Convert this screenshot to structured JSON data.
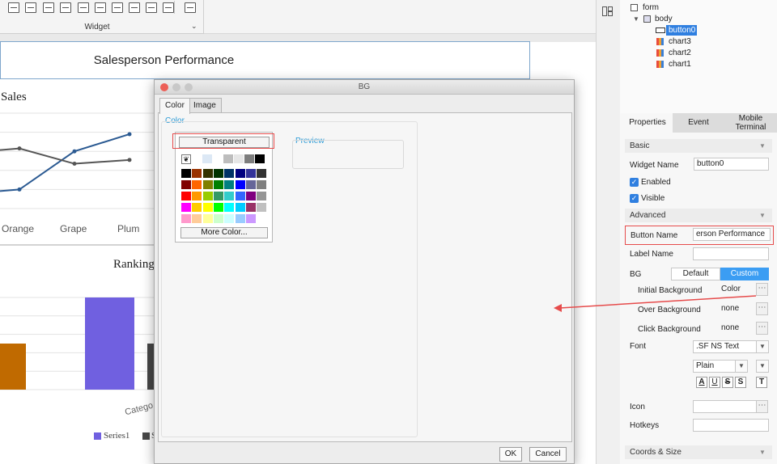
{
  "toolbar": {
    "group_label": "Widget"
  },
  "canvas": {
    "title": "Salesperson Performance",
    "chart3": {
      "title": "Sales",
      "categories": [
        "Orange",
        "Grape",
        "Plum"
      ]
    },
    "chart2": {
      "title": "Ranking",
      "axis_label": "Catego",
      "legend": [
        "Series1",
        "S"
      ]
    }
  },
  "chart_data": [
    {
      "type": "line",
      "title": "Sales",
      "categories": [
        "Orange",
        "Grape",
        "Plum"
      ],
      "series": [
        {
          "values": [
            20,
            60,
            78
          ],
          "color": "#2b5a92"
        },
        {
          "values": [
            63,
            47,
            51
          ],
          "color": "#555555"
        }
      ],
      "ylim": [
        0,
        100
      ],
      "grid": true
    },
    {
      "type": "bar",
      "title": "Ranking",
      "xlabel": "Catego",
      "series": [
        {
          "name": "Series1",
          "values": [
            100
          ],
          "color": "#7060e0"
        },
        {
          "name": "S",
          "values": [
            50
          ],
          "color": "#474747"
        }
      ],
      "partial_values": [
        50
      ],
      "partial_color": "#c06a00",
      "ylim": [
        0,
        100
      ],
      "grid": true
    }
  ],
  "dialog": {
    "title": "BG",
    "tabs": [
      "Color",
      "Image"
    ],
    "section_label": "Color",
    "transparent_label": "Transparent",
    "more_color_label": "More Color...",
    "preview_label": "Preview",
    "ok_label": "OK",
    "cancel_label": "Cancel",
    "top_row_colors": [
      "#dce8f5",
      "#ffffff",
      "#bdbdbd",
      "#e6e6e6",
      "#7d7d7d",
      "#000000"
    ],
    "palette_rows": [
      [
        "#000000",
        "#993300",
        "#333300",
        "#003300",
        "#003366",
        "#000080",
        "#333399",
        "#333333"
      ],
      [
        "#800000",
        "#ff6600",
        "#808000",
        "#008000",
        "#008080",
        "#0000ff",
        "#666699",
        "#808080"
      ],
      [
        "#ff0000",
        "#ff9900",
        "#99cc00",
        "#339966",
        "#33cccc",
        "#3366ff",
        "#800080",
        "#969696"
      ],
      [
        "#ff00ff",
        "#ffcc00",
        "#ffff00",
        "#00ff00",
        "#00ffff",
        "#00ccff",
        "#993366",
        "#c0c0c0"
      ],
      [
        "#ff99cc",
        "#ffcc99",
        "#ffff99",
        "#ccffcc",
        "#ccffff",
        "#99ccff",
        "#cc99ff",
        "#ffffff"
      ]
    ]
  },
  "tree": {
    "items": [
      "form",
      "body",
      "button0",
      "chart3",
      "chart2",
      "chart1"
    ]
  },
  "properties": {
    "tabs": [
      "Properties",
      "Event",
      "Mobile Terminal"
    ],
    "basic_label": "Basic",
    "widget_name_label": "Widget Name",
    "widget_name_value": "button0",
    "enabled_label": "Enabled",
    "visible_label": "Visible",
    "advanced_label": "Advanced",
    "button_name_label": "Button Name",
    "button_name_value": "erson Performance",
    "label_name_label": "Label Name",
    "label_name_value": "",
    "bg_label": "BG",
    "bg_default": "Default",
    "bg_custom": "Custom",
    "initial_bg_label": "Initial Background",
    "initial_bg_value": "Color",
    "over_bg_label": "Over Background",
    "over_bg_value": "none",
    "click_bg_label": "Click Background",
    "click_bg_value": "none",
    "font_label": "Font",
    "font_family_value": ".SF NS Text",
    "font_style_value": "Plain",
    "font_buttons": [
      "A",
      "U",
      "S",
      "S",
      "T"
    ],
    "icon_label": "Icon",
    "hotkeys_label": "Hotkeys",
    "coords_label": "Coords & Size",
    "accent_color": "#3b9df3",
    "highlight_color": "#e64b4b"
  }
}
